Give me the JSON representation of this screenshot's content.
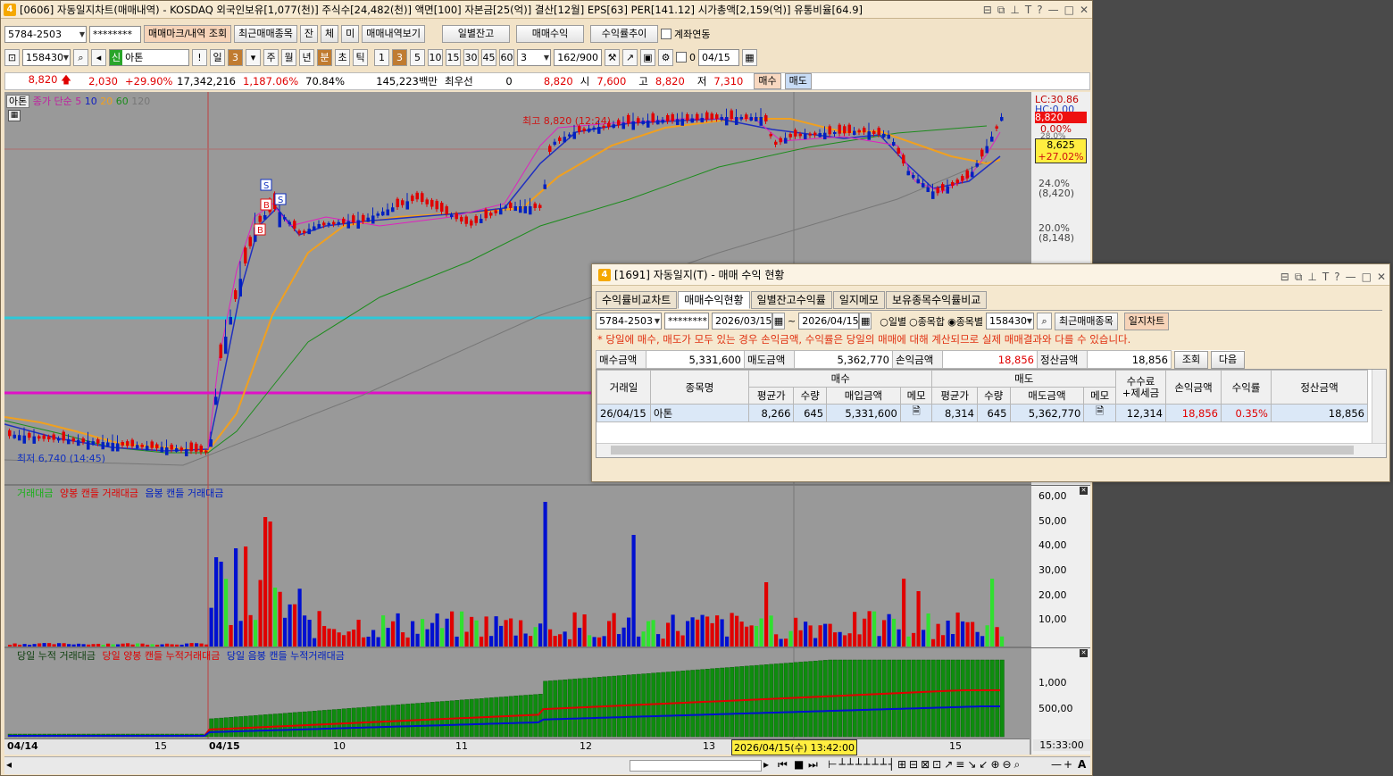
{
  "main": {
    "window_num": "4",
    "title": "[0606] 자동일지차트(매매내역) - KOSDAQ 외국인보유[1,077(천)] 주식수[24,482(천)] 액면[100] 자본금[25(억)] 결산[12월] EPS[63] PER[141.12] 시가총액[2,159(억)] 유통비율[64.9]",
    "toolbar1": {
      "account": "5784-2503",
      "password": "********",
      "btn_trade_mark": "매매마크/내역 조회",
      "btn_recent": "최근매매종목",
      "btn_jan": "잔",
      "btn_che": "체",
      "btn_mi": "미",
      "btn_view": "매매내역보기",
      "btn_balance": "일별잔고",
      "btn_profit": "매매수익",
      "btn_trend": "수익률추이",
      "chk_link": "계좌연동"
    },
    "toolbar2": {
      "code": "158430",
      "name_badge": "신",
      "name": "아톤",
      "mark": "!",
      "day": "일",
      "num3": "3",
      "week": "주",
      "month": "월",
      "year": "년",
      "min": "분",
      "sec": "초",
      "tick": "틱",
      "n1": "1",
      "n3": "3",
      "n5": "5",
      "n10": "10",
      "n15": "15",
      "n30": "30",
      "n45": "45",
      "n60": "60",
      "interval": "3",
      "count": "162",
      "count_max": "/900",
      "chk0": "0",
      "date": "04/15"
    },
    "quote": {
      "price": "8,820",
      "change": "2,030",
      "rate": "+29.90%",
      "volume": "17,342,216",
      "vol_rate": "1,187.06%",
      "ratio": "70.84%",
      "amount": "145,223백만",
      "label_pref": "최우선",
      "pref_val": "0",
      "ask": "8,820",
      "open_lbl": "시",
      "open": "7,600",
      "high_lbl": "고",
      "high": "8,820",
      "low_lbl": "저",
      "low": "7,310",
      "btn_buy": "매수",
      "btn_sell": "매도"
    },
    "chart": {
      "legend": {
        "name": "아톤",
        "ma_label": "종가 단순",
        "ma5": "5",
        "ma10": "10",
        "ma20": "20",
        "ma60": "60",
        "ma120": "120"
      },
      "high_label": "최고 8,820 (12:24)",
      "low_label": "최저 6,740 (14:45)",
      "right_scale": {
        "lc": "LC:30.86",
        "hc": "HC:0.00",
        "cur": "8,820",
        "cur_pct": "0.00%",
        "p1": "28.0%",
        "box_price": "8,625",
        "box_pct": "+27.02%",
        "p2": "24.0%",
        "p2v": "(8,420)",
        "p3": "20.0%",
        "p3v": "(8,148)"
      },
      "vol_legend": {
        "a": "거래대금",
        "b": "양봉 캔들 거래대금",
        "c": "음봉 캔들 거래대금"
      },
      "vol_scale": [
        "60,00",
        "50,00",
        "40,00",
        "30,00",
        "20,00",
        "10,00"
      ],
      "cum_legend": {
        "a": "당일 누적 거래대금",
        "b": "당일 양봉 캔들 누적거래대금",
        "c": "당일 음봉 캔들 누적거래대금"
      },
      "cum_scale": [
        "1,000",
        "500,00"
      ],
      "xaxis": {
        "d1": "04/14",
        "t1": "15",
        "d2": "04/15",
        "t2": "10",
        "t3": "11",
        "t4": "12",
        "t5": "13",
        "cursor": "2026/04/15(수) 13:42:00",
        "t6": "15",
        "time": "15:33:00"
      }
    }
  },
  "popup": {
    "window_num": "4",
    "title": "[1691] 자동일지(T) - 매매 수익 현황",
    "tabs": [
      "수익률비교차트",
      "매매수익현황",
      "일별잔고수익률",
      "일지메모",
      "보유종목수익률비교"
    ],
    "account": "5784-2503",
    "password": "********",
    "date_from": "2026/03/15",
    "tilde": "~",
    "date_to": "2026/04/15",
    "radio_daily": "일별",
    "radio_sum": "종목합",
    "radio_item": "종목별",
    "code": "158430",
    "btn_recent": "최근매매종목",
    "btn_daily_chart": "일지차트",
    "notice": "* 당일에 매수, 매도가 모두 있는 경우 손익금액, 수익률은 당일의 매매에 대해 계산되므로 실제 매매결과와 다를 수 있습니다.",
    "summary": {
      "buy_lbl": "매수금액",
      "buy": "5,331,600",
      "sell_lbl": "매도금액",
      "sell": "5,362,770",
      "pl_lbl": "손익금액",
      "pl": "18,856",
      "settle_lbl": "정산금액",
      "settle": "18,856",
      "btn_query": "조회",
      "btn_next": "다음"
    },
    "table": {
      "h_date": "거래일",
      "h_name": "종목명",
      "h_buy": "매수",
      "h_sell": "매도",
      "h_fee": "수수료",
      "h_fee2": "+제세금",
      "h_pl": "손익금액",
      "h_rate": "수익률",
      "h_settle": "정산금액",
      "h_avg": "평균가",
      "h_qty": "수량",
      "h_buy_amt": "매입금액",
      "h_memo": "메모",
      "h_avg2": "평균가",
      "h_qty2": "수량",
      "h_sell_amt": "매도금액",
      "h_memo2": "메모",
      "rows": [
        {
          "date": "26/04/15",
          "name": "아톤",
          "b_avg": "8,266",
          "b_qty": "645",
          "b_amt": "5,331,600",
          "s_avg": "8,314",
          "s_qty": "645",
          "s_amt": "5,362,770",
          "fee": "12,314",
          "pl": "18,856",
          "rate": "0.35%",
          "settle": "18,856"
        }
      ]
    }
  }
}
